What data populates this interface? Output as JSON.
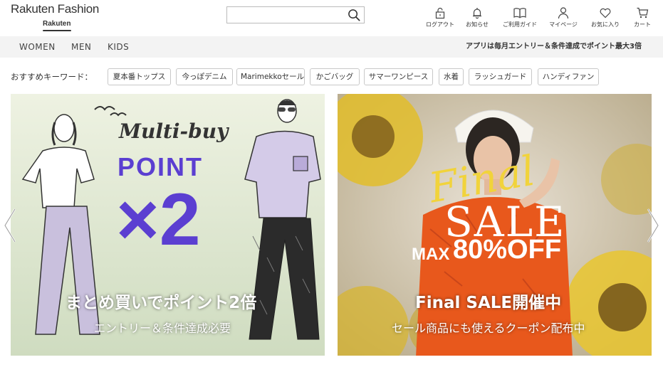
{
  "header": {
    "logo_text": "Rakuten Fashion",
    "logo_sub": "Rakuten",
    "search": {
      "placeholder": "",
      "value": ""
    },
    "utilities": [
      {
        "label": "ログアウト",
        "icon": "logout-lock-icon"
      },
      {
        "label": "お知らせ",
        "icon": "bell-icon"
      },
      {
        "label": "ご利用ガイド",
        "icon": "book-icon"
      },
      {
        "label": "マイページ",
        "icon": "user-icon"
      },
      {
        "label": "お気に入り",
        "icon": "heart-icon"
      },
      {
        "label": "カート",
        "icon": "cart-icon"
      }
    ]
  },
  "categories": [
    "WOMEN",
    "MEN",
    "KIDS"
  ],
  "promo_text": "アプリは毎月エントリー＆条件達成でポイント最大3倍",
  "keywords": {
    "label": "おすすめキーワード：",
    "items": [
      "夏本番トップス",
      "今っぽデニム",
      "Marimekkoセール",
      "かごバッグ",
      "サマーワンピース",
      "水着",
      "ラッシュガード",
      "ハンディファン"
    ]
  },
  "banners": [
    {
      "script_text": "Multi-buy",
      "point_text": "POINT",
      "multiplier_text": "×2",
      "headline": "まとめ買いでポイント2倍",
      "subline": "エントリー＆条件達成必要",
      "bg_color": "#e6ecd8",
      "accent_color": "#5b3fd1"
    },
    {
      "script_text": "Final",
      "sale_text": "SALE",
      "max_text": "MAX",
      "percent_text": "80%OFF",
      "headline": "Final SALE開催中",
      "subline": "セール商品にも使えるクーポン配布中",
      "accent_color": "#f1d33b",
      "dress_color": "#e8581c"
    }
  ]
}
